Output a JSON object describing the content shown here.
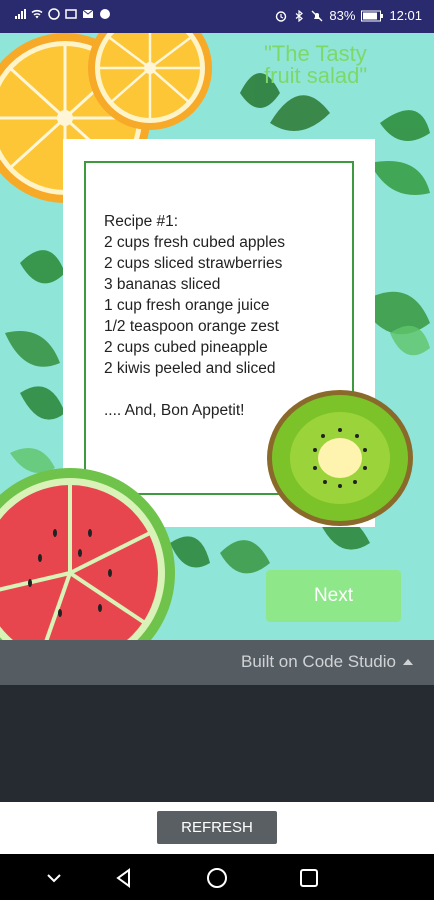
{
  "status_bar": {
    "battery": "83%",
    "time": "12:01"
  },
  "app": {
    "title": "\"The Tasty fruit salad\"",
    "recipe_lines": [
      "Recipe #1:",
      "2 cups fresh cubed apples",
      "2 cups sliced strawberries",
      "3 bananas sliced",
      "1 cup fresh orange juice",
      "1/2 teaspoon orange zest",
      "2 cups cubed pineapple",
      "2 kiwis peeled and sliced",
      "",
      ".... And, Bon Appetit!"
    ],
    "next_label": "Next"
  },
  "code_studio": {
    "label": "Built on Code Studio"
  },
  "refresh": {
    "label": "REFRESH"
  },
  "colors": {
    "background": "#8fe5d8",
    "title": "#7dd86a",
    "next_button": "#8ee88a",
    "card_border": "#3f9a3f"
  }
}
